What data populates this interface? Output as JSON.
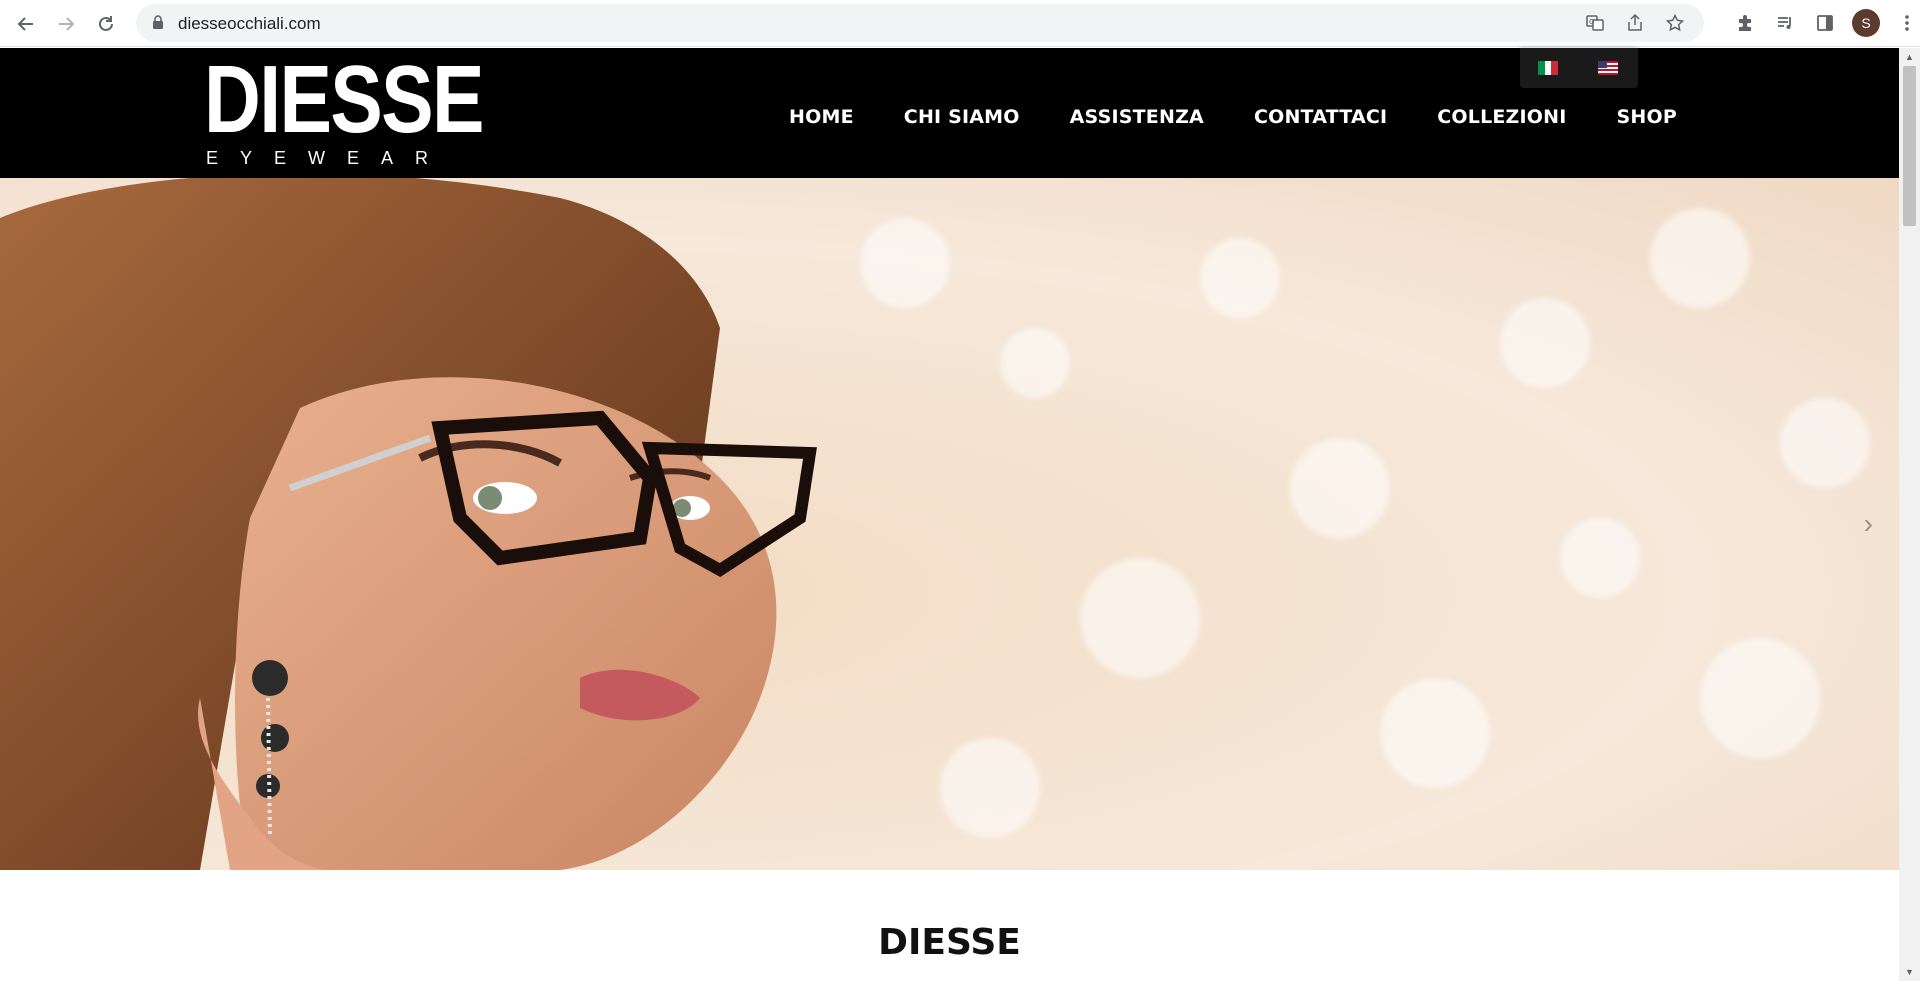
{
  "browser": {
    "url": "diesseocchiali.com",
    "profile_initial": "S",
    "icons": {
      "back": "arrow-left-icon",
      "forward": "arrow-right-icon",
      "reload": "reload-icon",
      "lock": "lock-icon",
      "translate": "translate-icon",
      "share": "share-icon",
      "bookmark": "star-icon",
      "extensions": "puzzle-icon",
      "media": "playlist-icon",
      "sidepanel": "side-panel-icon",
      "menu": "kebab-menu-icon"
    }
  },
  "site": {
    "logo": {
      "brand": "DIESSE",
      "tagline": "EYEWEAR"
    },
    "languages": [
      "it",
      "en-us"
    ],
    "nav": [
      {
        "label": "HOME"
      },
      {
        "label": "CHI SIAMO"
      },
      {
        "label": "ASSISTENZA"
      },
      {
        "label": "CONTATTACI"
      },
      {
        "label": "COLLEZIONI"
      },
      {
        "label": "SHOP"
      }
    ],
    "hero": {
      "next_arrow": "›"
    },
    "section_title": "DIESSE"
  },
  "colors": {
    "header_bg": "#000000",
    "nav_text": "#ffffff",
    "hero_bg": "#f4e3d0"
  }
}
